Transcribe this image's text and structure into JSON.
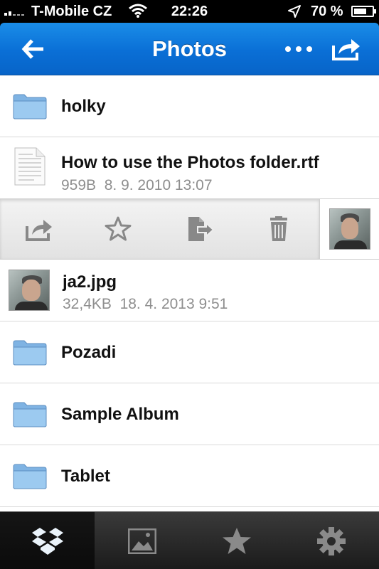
{
  "status_bar": {
    "carrier": "T-Mobile CZ",
    "time": "22:26",
    "battery_percent": "70 %",
    "battery_level": 0.7
  },
  "nav": {
    "title": "Photos",
    "back_icon": "back-arrow-icon",
    "more_icon": "more-dots-icon",
    "share_icon": "share-icon"
  },
  "list": {
    "items": [
      {
        "type": "folder",
        "name": "holky"
      },
      {
        "type": "file",
        "name": "How to use the Photos folder.rtf",
        "size": "959B",
        "date": "8. 9. 2010 13:07"
      },
      {
        "type": "image",
        "name": "ja2.jpg",
        "size": "32,4KB",
        "date": "18. 4. 2013 9:51"
      },
      {
        "type": "folder",
        "name": "Pozadi"
      },
      {
        "type": "folder",
        "name": "Sample Album"
      },
      {
        "type": "folder",
        "name": "Tablet"
      }
    ]
  },
  "action_strip": {
    "actions": [
      "share-icon",
      "favorite-star-icon",
      "move-file-icon",
      "delete-trash-icon"
    ]
  },
  "tab_bar": {
    "tabs": [
      "dropbox-icon",
      "photos-icon",
      "favorites-star-icon",
      "settings-gear-icon"
    ],
    "active": 0
  },
  "colors": {
    "nav_blue": "#0a6fd6",
    "folder_blue": "#8fc1ec",
    "meta_gray": "#8e8e8e"
  }
}
